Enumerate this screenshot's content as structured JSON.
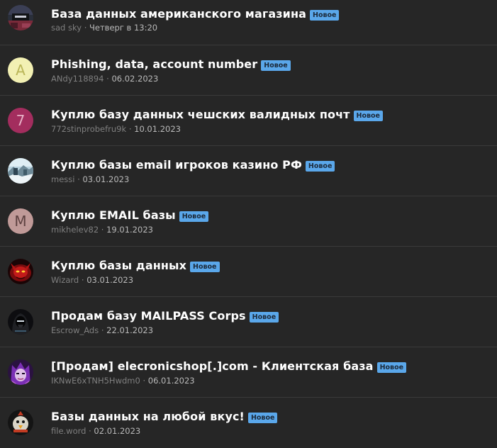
{
  "threads": [
    {
      "title": "База данных американского магазина",
      "badge": "Новое",
      "author": "sad sky",
      "date": "Четверг в 13:20",
      "avatar": {
        "type": "image",
        "icon": "shop-avatar-icon"
      }
    },
    {
      "title": "Phishing, data, account number",
      "badge": "Новое",
      "author": "ANdy118894",
      "date": "06.02.2023",
      "avatar": {
        "type": "letter",
        "letter": "A",
        "bg": "#f2f0b3",
        "fg": "#bab658"
      }
    },
    {
      "title": "Куплю базу данных чешских валидных почт",
      "badge": "Новое",
      "author": "772stinprobefru9k",
      "date": "10.01.2023",
      "avatar": {
        "type": "letter",
        "letter": "7",
        "bg": "#a32d5e",
        "fg": "#e7b0c6"
      }
    },
    {
      "title": "Куплю базы email игроков казино РФ",
      "badge": "Новое",
      "author": "messi",
      "date": "03.01.2023",
      "avatar": {
        "type": "image",
        "icon": "snow-landscape-avatar-icon"
      }
    },
    {
      "title": "Куплю EMAIL базы",
      "badge": "Новое",
      "author": "mikhelev82",
      "date": "19.01.2023",
      "avatar": {
        "type": "letter",
        "letter": "M",
        "bg": "#c09a98",
        "fg": "#5d4140"
      }
    },
    {
      "title": "Куплю базы данных",
      "badge": "Новое",
      "author": "Wizard",
      "date": "03.01.2023",
      "avatar": {
        "type": "image",
        "icon": "red-demon-avatar-icon"
      }
    },
    {
      "title": "Продам базу MAILPASS Corps",
      "badge": "Новое",
      "author": "Escrow_Ads",
      "date": "22.01.2023",
      "avatar": {
        "type": "image",
        "icon": "hooded-figure-avatar-icon"
      }
    },
    {
      "title": "[Продам] elecronicshop[.]com - Клиентская база",
      "badge": "Новое",
      "author": "IKNwE6xTNH5Hwdm0",
      "date": "06.01.2023",
      "avatar": {
        "type": "image",
        "icon": "purple-character-avatar-icon"
      }
    },
    {
      "title": "Базы данных на любой вкус!",
      "badge": "Новое",
      "author": "file.word",
      "date": "02.01.2023",
      "avatar": {
        "type": "image",
        "icon": "bird-avatar-icon"
      }
    }
  ],
  "colors": {
    "background": "#262626",
    "divider": "#3a3a3a",
    "title": "#ffffff",
    "badge_bg": "#5aa7ea",
    "author": "#7f7f7f",
    "date": "#b9b9b9"
  }
}
